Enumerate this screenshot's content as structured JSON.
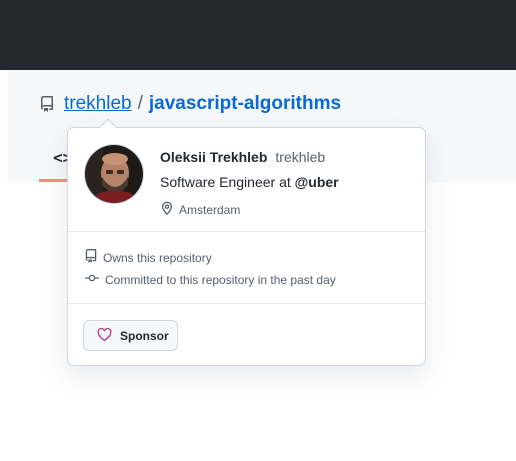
{
  "colors": {
    "topbar": "#24292f",
    "header_bg": "#f6f8fa",
    "link": "#0969da",
    "muted": "#57606a",
    "tab_underline": "#fd8c73",
    "sponsor_heart": "#bf3989"
  },
  "breadcrumb": {
    "icon": "repo-icon",
    "owner": "trekhleb",
    "separator": "/",
    "repo": "javascript-algorithms"
  },
  "tabs": {
    "code_peek": "<>"
  },
  "hovercard": {
    "avatar": "avatar-photo",
    "name": "Oleksii Trekhleb",
    "login": "trekhleb",
    "bio_prefix": "Software Engineer at ",
    "bio_company": "@uber",
    "location_icon": "location-pin-icon",
    "location": "Amsterdam",
    "owns_icon": "repo-icon",
    "owns": "Owns this repository",
    "commit_icon": "git-commit-icon",
    "committed": "Committed to this repository in the past day",
    "sponsor_icon": "heart-icon",
    "sponsor": "Sponsor"
  }
}
